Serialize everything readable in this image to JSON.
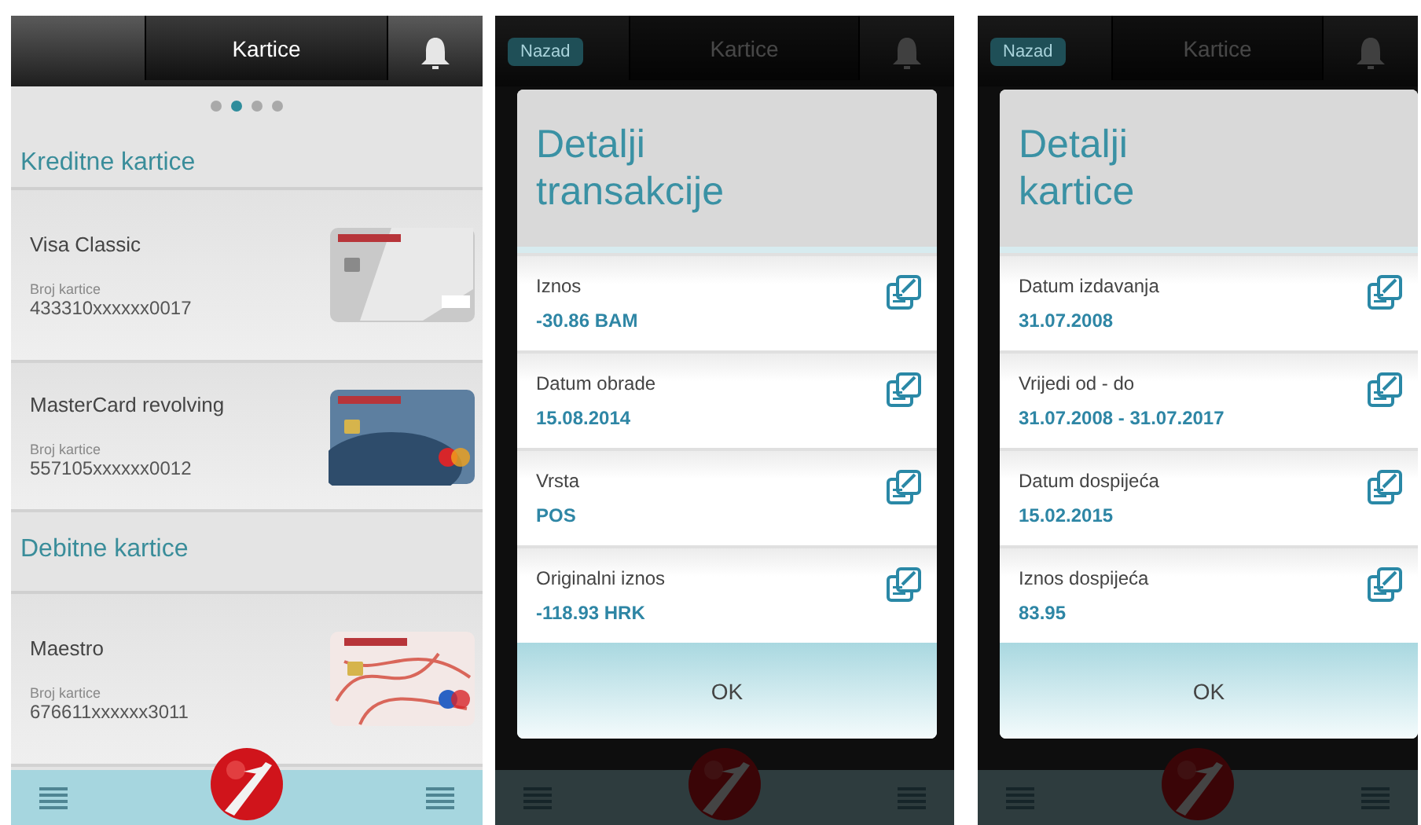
{
  "screens": [
    {
      "kind": "list",
      "header": {
        "title": "Kartice"
      },
      "pager": [
        {
          "selected": false
        },
        {
          "selected": true
        },
        {
          "selected": false
        },
        {
          "selected": false
        }
      ],
      "sections": [
        {
          "title": "Kreditne kartice",
          "cards": [
            {
              "name": "Visa Classic",
              "number_label": "Broj kartice",
              "number": "433310xxxxxx0017",
              "kind": "silver"
            },
            {
              "name": "MasterCard revolving",
              "number_label": "Broj kartice",
              "number": "557105xxxxxx0012",
              "kind": "blue"
            }
          ]
        },
        {
          "title": "Debitne kartice",
          "cards": [
            {
              "name": "Maestro",
              "number_label": "Broj kartice",
              "number": "676611xxxxxx3011",
              "kind": "map"
            }
          ]
        }
      ]
    },
    {
      "kind": "dialog",
      "header": {
        "back": "Nazad",
        "title": "Kartice"
      },
      "dialog": {
        "title": "Detalji transakcije",
        "button": "OK",
        "fields": [
          {
            "label": "Iznos",
            "value": "-30.86 BAM"
          },
          {
            "label": "Datum obrade",
            "value": "15.08.2014"
          },
          {
            "label": "Vrsta",
            "value": "POS"
          },
          {
            "label": "Originalni iznos",
            "value": "-118.93 HRK"
          }
        ]
      }
    },
    {
      "kind": "dialog",
      "header": {
        "back": "Nazad",
        "title": "Kartice"
      },
      "dialog": {
        "title": "Detalji kartice",
        "button": "OK",
        "fields": [
          {
            "label": "Datum izdavanja",
            "value": "31.07.2008"
          },
          {
            "label": "Vrijedi od - do",
            "value": "31.07.2008 - 31.07.2017"
          },
          {
            "label": "Datum dospijeća",
            "value": "15.02.2015"
          },
          {
            "label": "Iznos dospijeća",
            "value": "83.95"
          }
        ]
      }
    }
  ]
}
